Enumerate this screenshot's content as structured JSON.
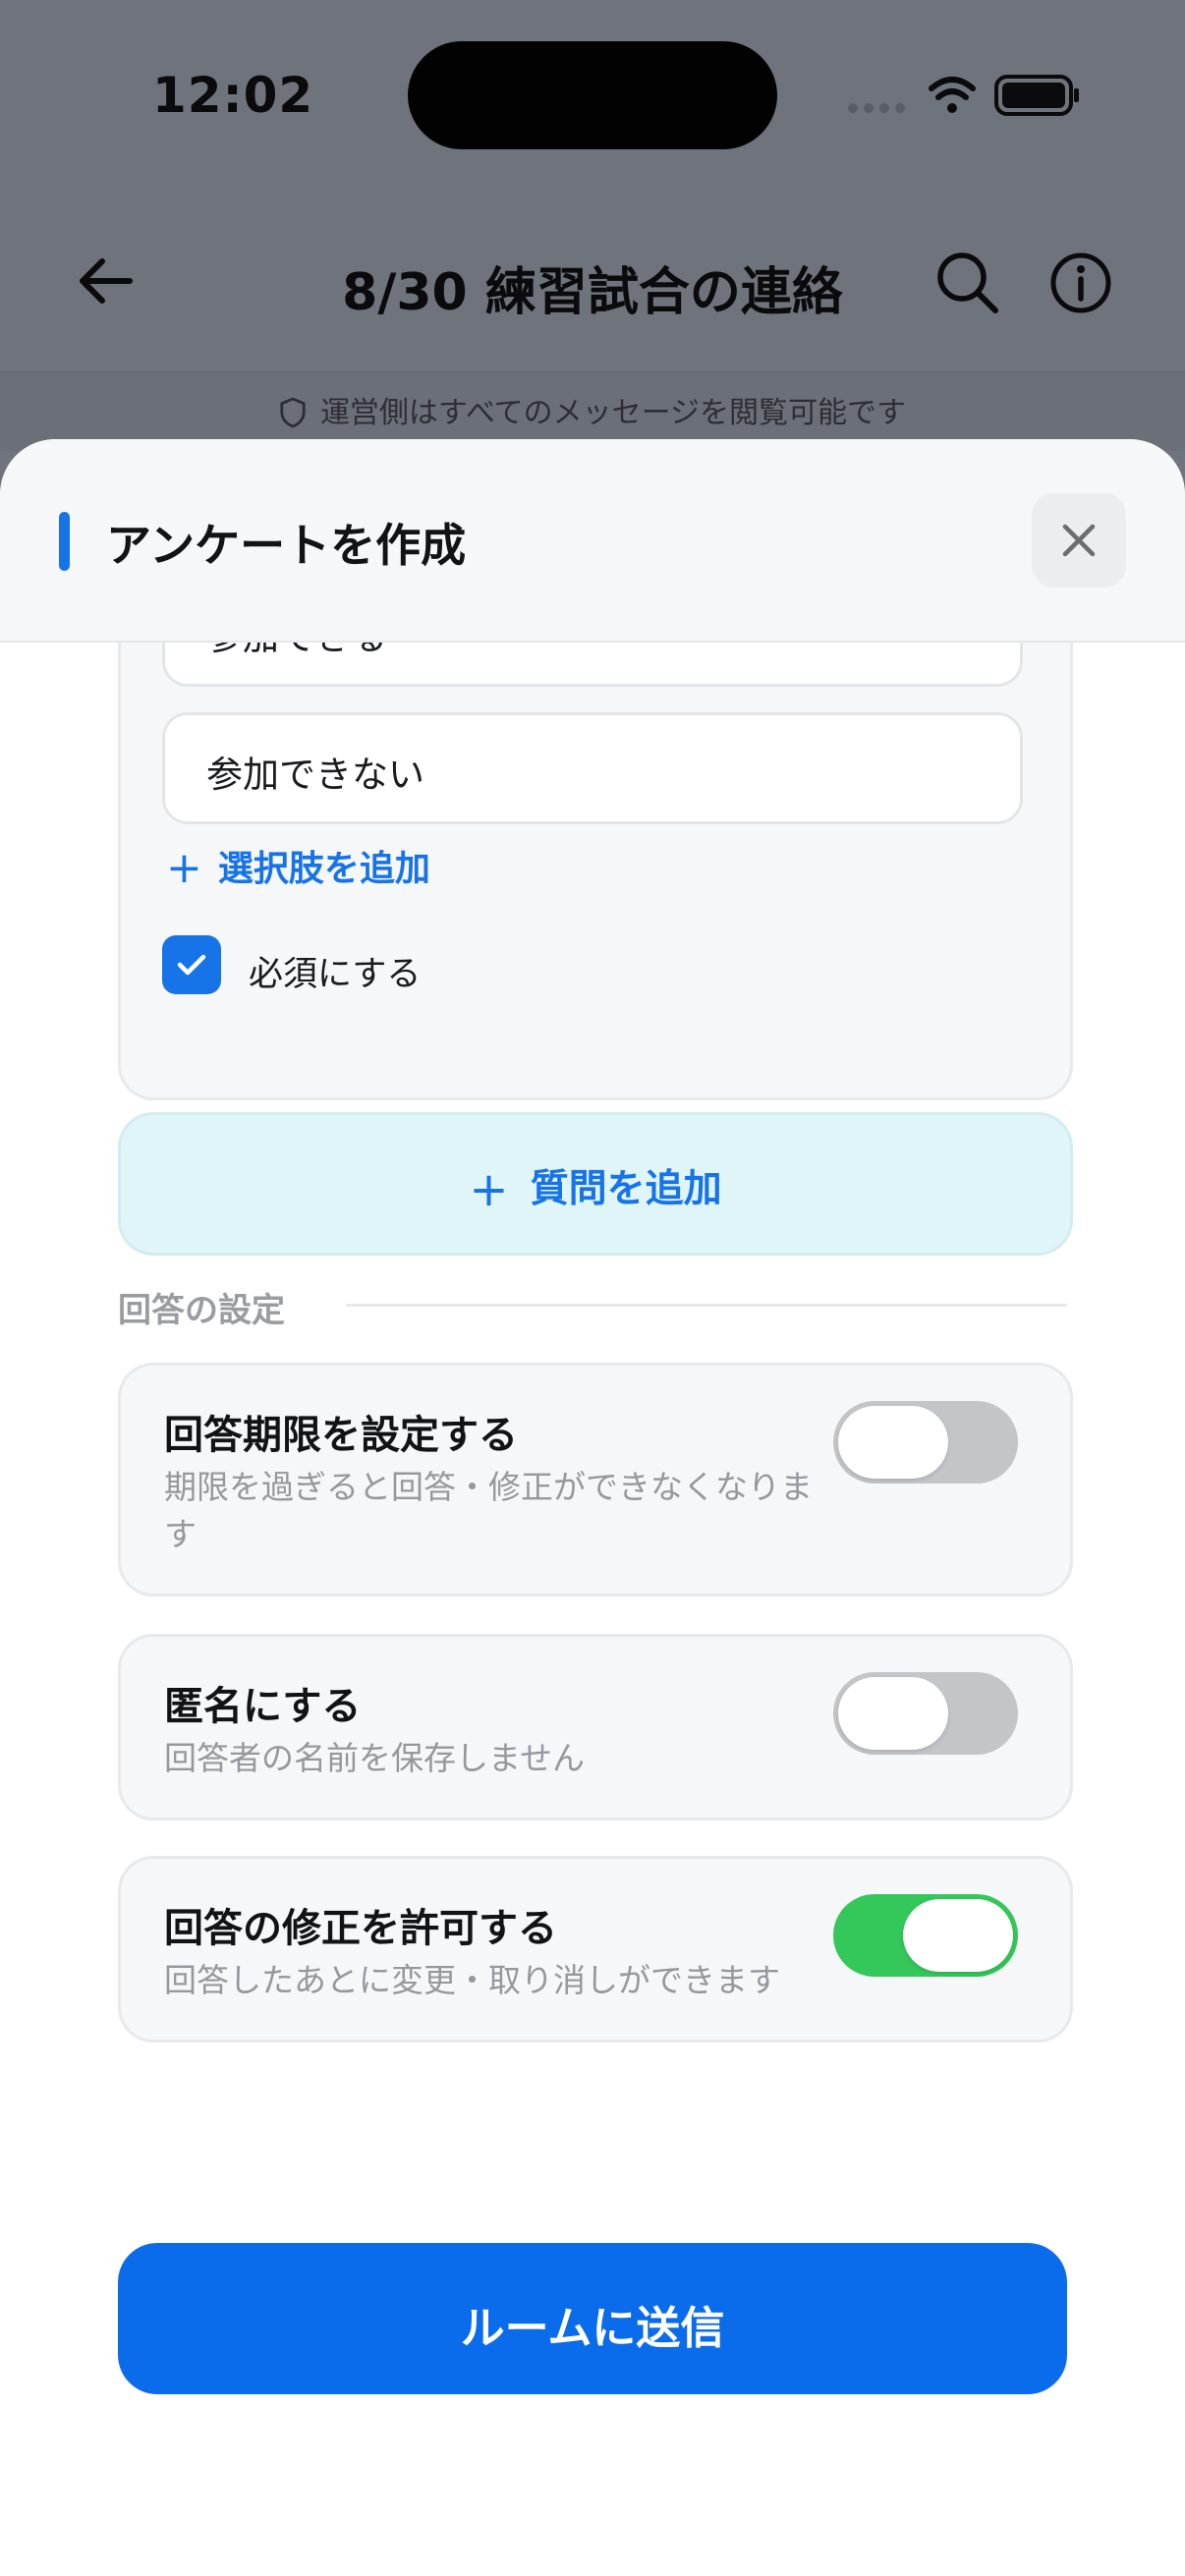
{
  "status_bar": {
    "time": "12:02"
  },
  "nav": {
    "title": "8/30 練習試合の連絡"
  },
  "notice": {
    "text": "運営側はすべてのメッセージを閲覧可能です"
  },
  "sheet": {
    "title": "アンケートを作成",
    "question": {
      "options": [
        "参加できる",
        "参加できない"
      ],
      "add_option_label": "選択肢を追加",
      "required_label": "必須にする",
      "required_checked": true
    },
    "add_question_label": "質問を追加",
    "settings_section_label": "回答の設定",
    "settings": [
      {
        "title": "回答期限を設定する",
        "description": "期限を過ぎると回答・修正ができなくなります",
        "enabled": false
      },
      {
        "title": "匿名にする",
        "description": "回答者の名前を保存しません",
        "enabled": false
      },
      {
        "title": "回答の修正を許可する",
        "description": "回答したあとに変更・取り消しができます",
        "enabled": true
      }
    ],
    "submit_label": "ルームに送信"
  },
  "colors": {
    "accent": "#1673e8",
    "toggle_on": "#34c759",
    "submit": "#0b6ceb"
  }
}
